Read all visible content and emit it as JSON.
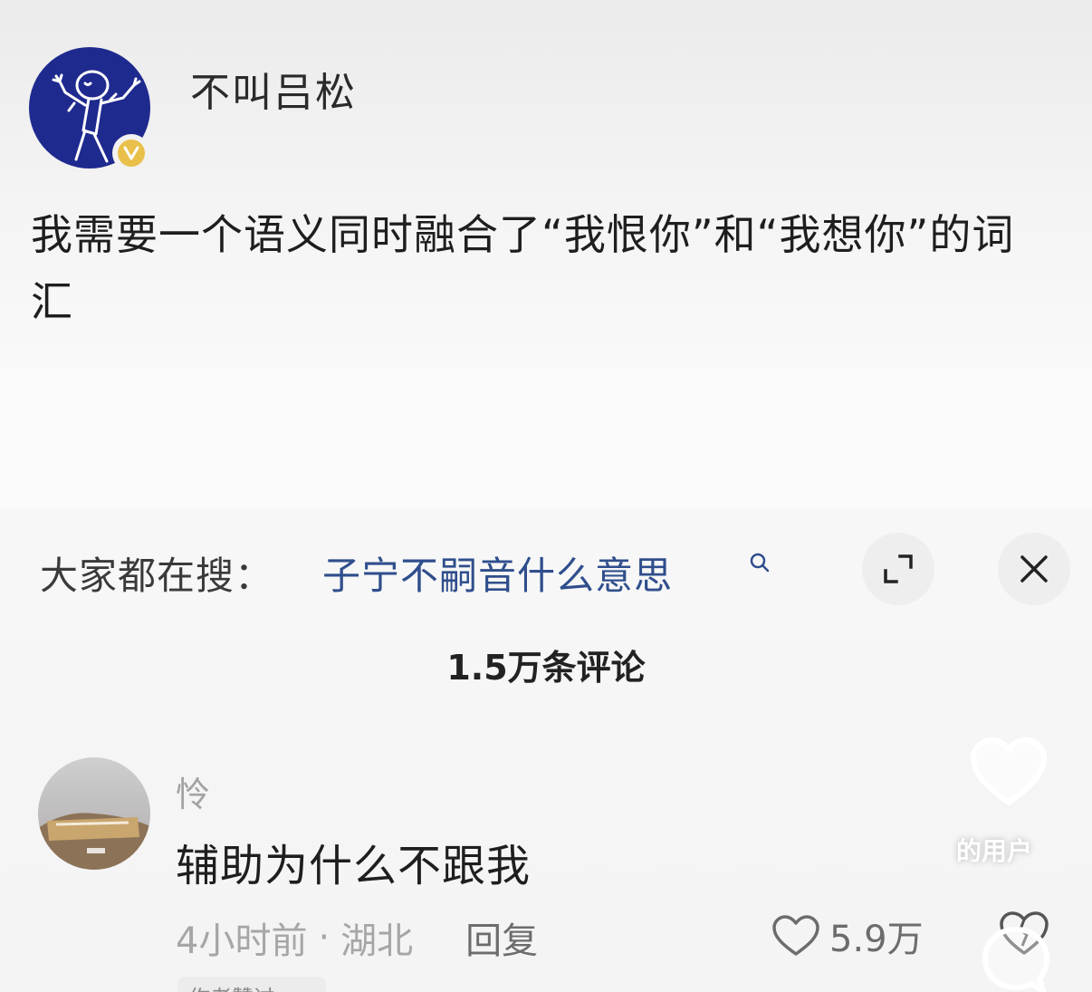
{
  "post": {
    "username": "不叫吕松",
    "text": "我需要一个语义同时融合了“我恨你”和“我想你”的词汇"
  },
  "search_bar": {
    "prefix": "大家都在搜：",
    "query": "子宁不嗣音什么意思"
  },
  "comments_section": {
    "count_label": "1.5万条评论",
    "comment": {
      "author": "怜",
      "text": "辅助为什么不跟我",
      "time": "4小时前",
      "separator": "·",
      "location": "湖北",
      "reply_label": "回复",
      "like_count": "5.9万",
      "tag": "作者赞过"
    },
    "floating_label": "的用户"
  },
  "colors": {
    "avatar_bg": "#1f2a8f",
    "search_link": "#2f4e8c",
    "badge": "#e9c04a"
  }
}
